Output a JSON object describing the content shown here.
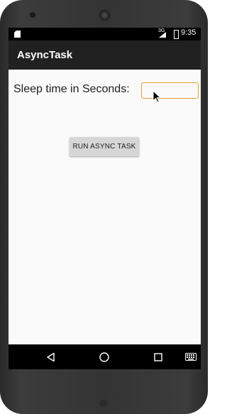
{
  "status_bar": {
    "time": "9:35",
    "signal_label": "3G"
  },
  "app_bar": {
    "title": "AsyncTask"
  },
  "form": {
    "sleep_label": "Sleep time in Seconds:",
    "sleep_value": "",
    "run_button_label": "RUN ASYNC TASK"
  },
  "nav_bar": {
    "icons": [
      "back-icon",
      "home-icon",
      "recents-icon",
      "keyboard-icon"
    ]
  }
}
